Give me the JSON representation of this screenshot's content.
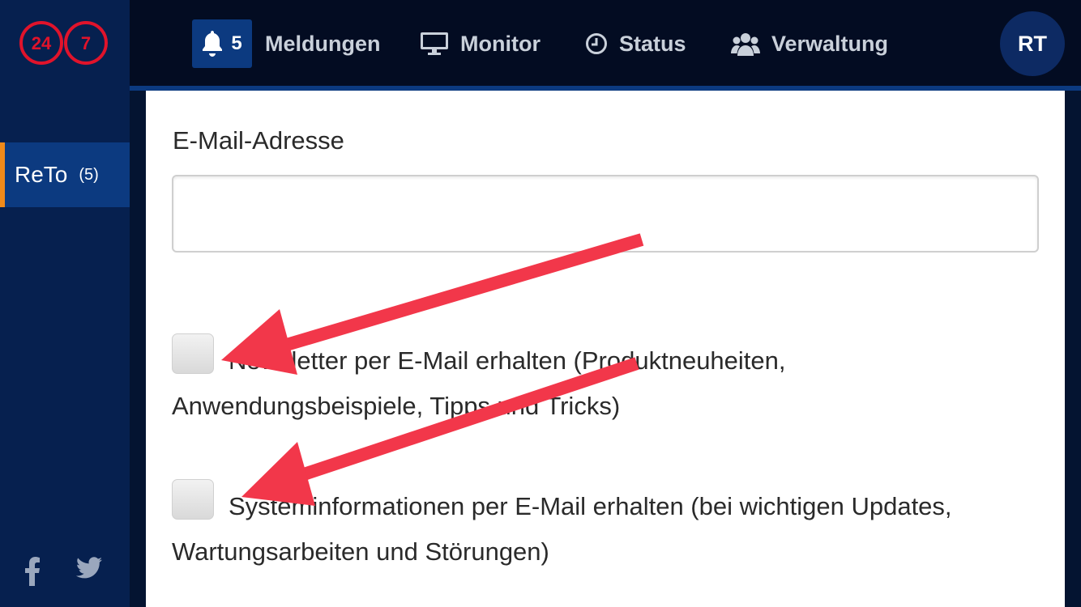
{
  "logo": {
    "left_number": "24",
    "right_number": "7"
  },
  "sidebar": {
    "items": [
      {
        "label": "ReTo",
        "count": "(5)"
      }
    ],
    "social": [
      "facebook-icon",
      "twitter-icon"
    ]
  },
  "nav": {
    "notifications": {
      "count": "5",
      "label": "Meldungen"
    },
    "monitor": "Monitor",
    "status": "Status",
    "admin": "Verwaltung"
  },
  "user": {
    "initials": "RT"
  },
  "form": {
    "email_label": "E-Mail-Adresse",
    "email_value": "",
    "options": [
      {
        "label": "Newsletter per E-Mail erhalten (Produktneuheiten, Anwendungsbeispiele, Tipps und Tricks)",
        "checked": false
      },
      {
        "label": "Systeminformationen per E-Mail erhalten (bei wichtigen Updates, Wartungsarbeiten und Störungen)",
        "checked": false
      }
    ]
  },
  "colors": {
    "sidebar": "#06204f",
    "topbar": "#030c22",
    "accent_blue": "#0c3a80",
    "accent_orange": "#f08a1a",
    "logo_red": "#e0132b",
    "annotation_arrow": "#f2374a"
  }
}
